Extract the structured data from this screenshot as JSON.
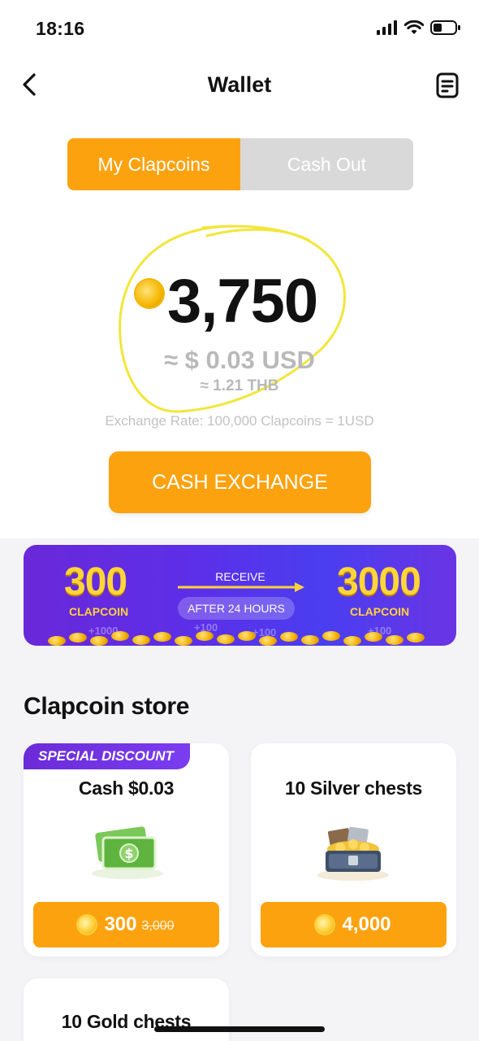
{
  "status_bar": {
    "time": "18:16"
  },
  "nav": {
    "title": "Wallet"
  },
  "tabs": [
    {
      "label": "My Clapcoins",
      "active": true
    },
    {
      "label": "Cash Out",
      "active": false
    }
  ],
  "balance": {
    "amount": "3,750",
    "usd": "≈ $ 0.03 USD",
    "thb": "≈ 1.21 THB",
    "exchange_rate": "Exchange Rate: 100,000 Clapcoins = 1USD"
  },
  "cash_exchange": {
    "label": "CASH EXCHANGE"
  },
  "promo": {
    "left_amount": "300",
    "left_unit": "CLAPCOIN",
    "receive": "RECEIVE",
    "after": "AFTER 24 HOURS",
    "right_amount": "3000",
    "right_unit": "CLAPCOIN",
    "plus_labels": [
      "+1000",
      "+100",
      "+100",
      "+100"
    ]
  },
  "store": {
    "title": "Clapcoin store",
    "items": [
      {
        "tag": "SPECIAL DISCOUNT",
        "title": "Cash $0.03",
        "price": "300",
        "old_price": "3,000",
        "icon": "cash-icon"
      },
      {
        "title": "10 Silver chests",
        "price": "4,000",
        "icon": "silver-chest-icon"
      },
      {
        "title": "10 Gold chests"
      }
    ]
  },
  "colors": {
    "accent": "#fda20f",
    "promo_purple": "#5c2fe8",
    "annotation_yellow": "#f5e93a"
  }
}
